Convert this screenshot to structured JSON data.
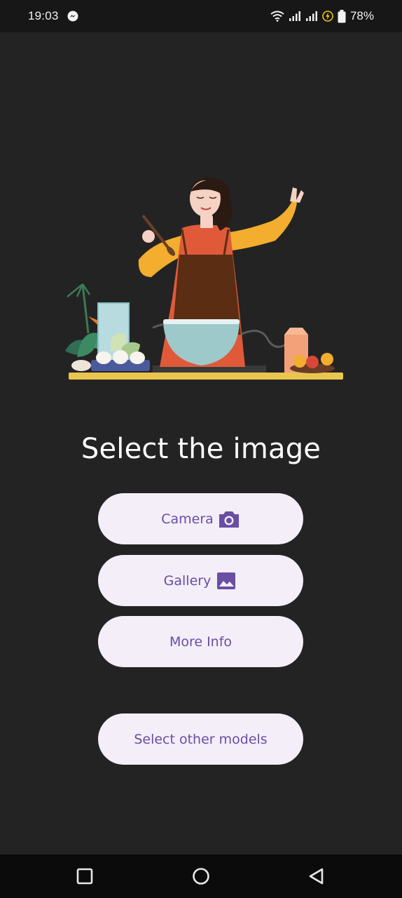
{
  "status_bar": {
    "time": "19:03",
    "battery_percent": "78%",
    "icons": [
      "messenger-icon",
      "wifi-icon",
      "signal-icon",
      "signal-icon",
      "charging-icon",
      "battery-icon"
    ]
  },
  "main": {
    "title": "Select the image",
    "buttons": {
      "camera": {
        "label": "Camera",
        "icon": "camera-icon"
      },
      "gallery": {
        "label": "Gallery",
        "icon": "image-icon"
      },
      "more_info": {
        "label": "More Info"
      },
      "select_models": {
        "label": "Select other models"
      }
    }
  },
  "nav_bar": {
    "icons": [
      "recent-apps-icon",
      "home-icon",
      "back-icon"
    ]
  },
  "colors": {
    "background": "#232323",
    "button_bg": "#f3eef8",
    "button_text": "#6a4ea3"
  }
}
